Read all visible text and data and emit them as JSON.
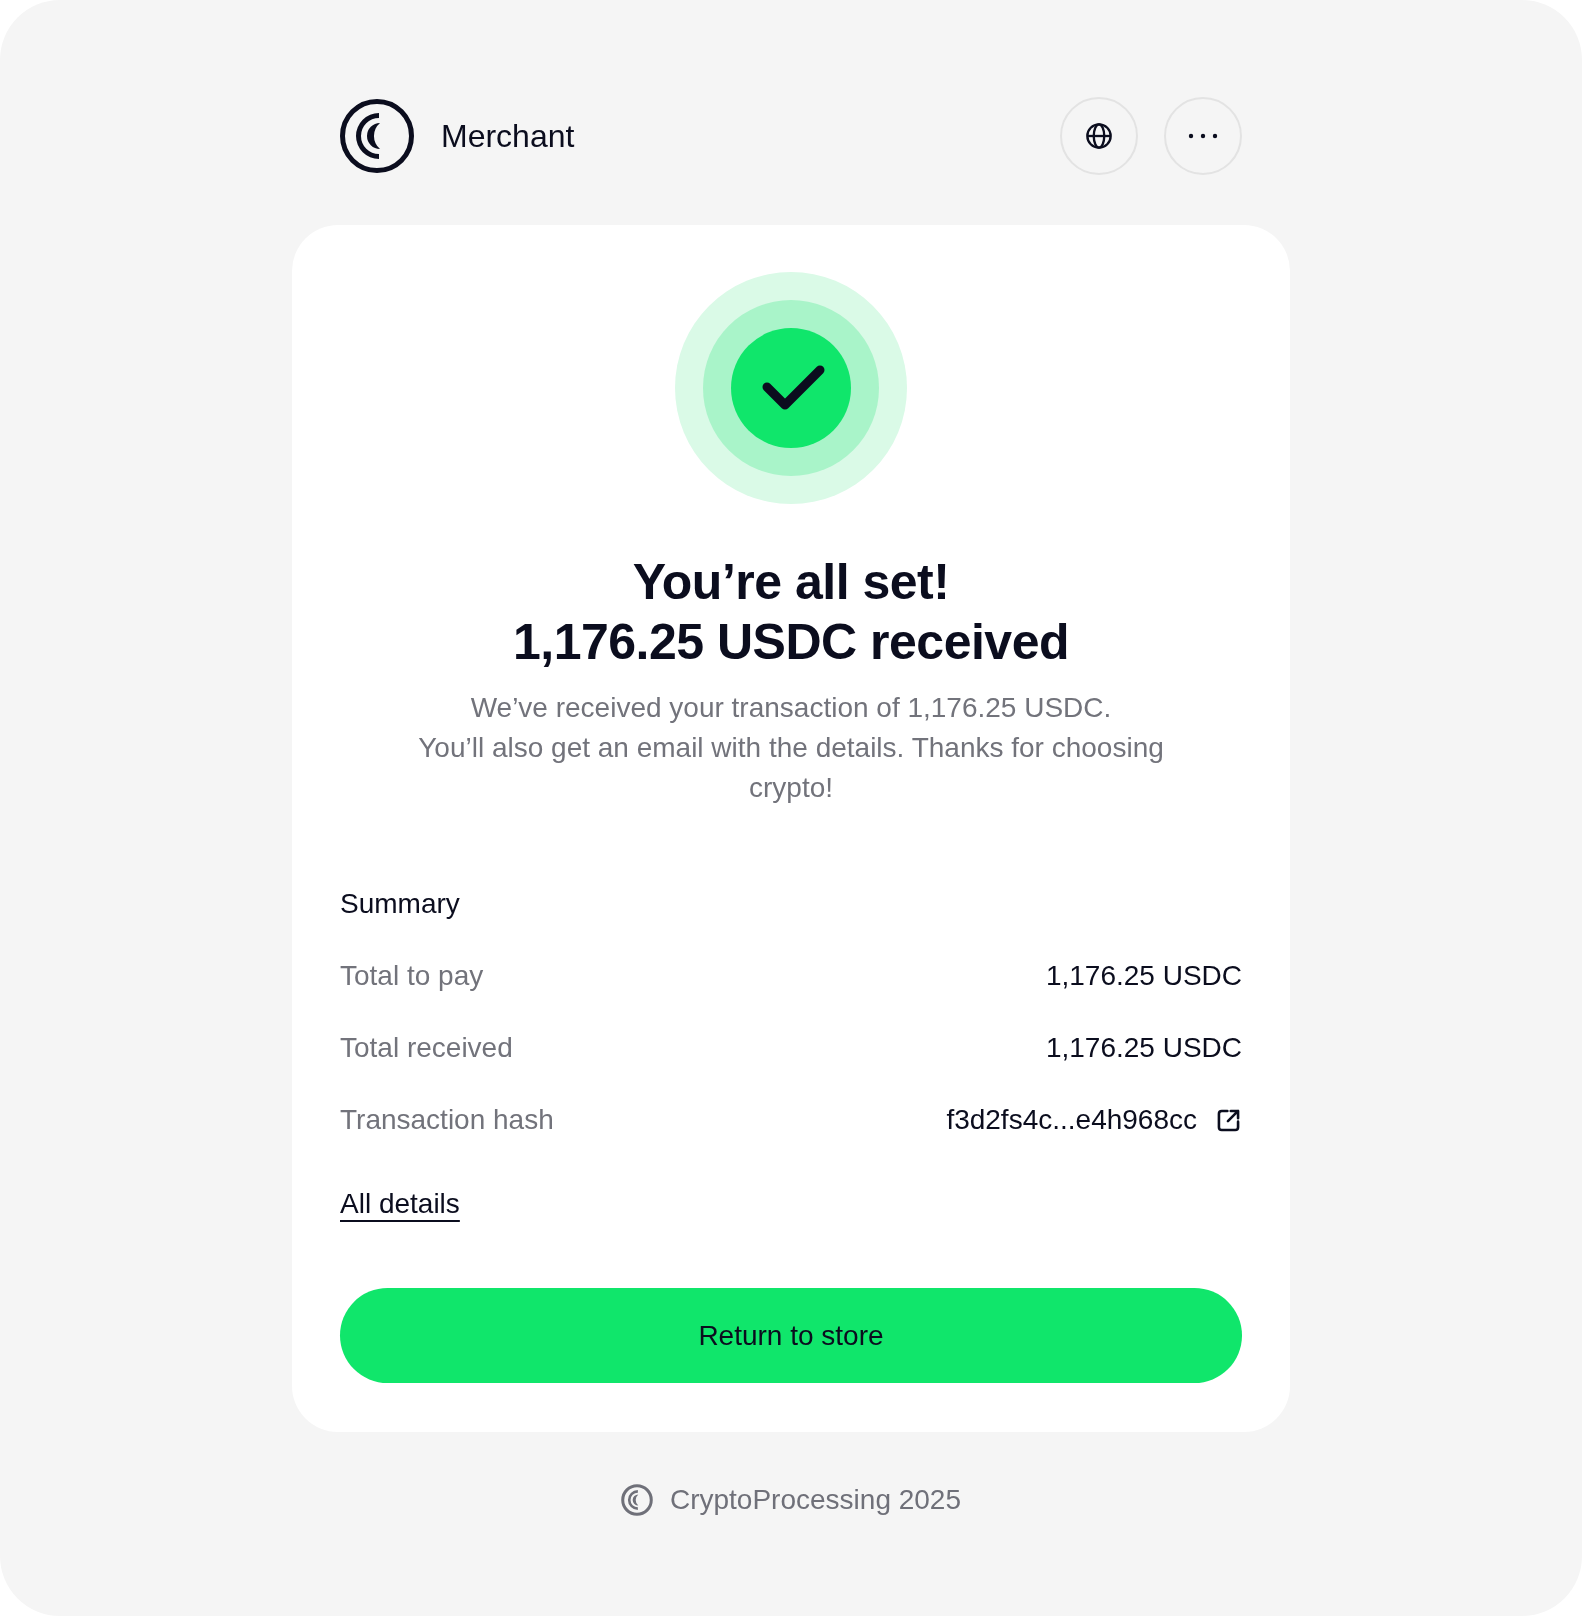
{
  "header": {
    "merchant_name": "Merchant"
  },
  "status": {
    "kind": "success",
    "title": "You’re all set!",
    "amount_line": "1,176.25 USDC received",
    "message": "We’ve received your transaction of 1,176.25 USDC.\nYou’ll also get an email with the details. Thanks for choosing crypto!"
  },
  "summary": {
    "title": "Summary",
    "rows": [
      {
        "label": "Total to pay",
        "value": "1,176.25 USDC",
        "kind": "text"
      },
      {
        "label": "Total received",
        "value": "1,176.25 USDC",
        "kind": "text"
      },
      {
        "label": "Transaction hash",
        "value": "f3d2fs4c...e4h968cc",
        "kind": "link"
      }
    ]
  },
  "details_link": "All details",
  "primary_button": "Return to store",
  "footer": {
    "text": "CryptoProcessing 2025"
  }
}
